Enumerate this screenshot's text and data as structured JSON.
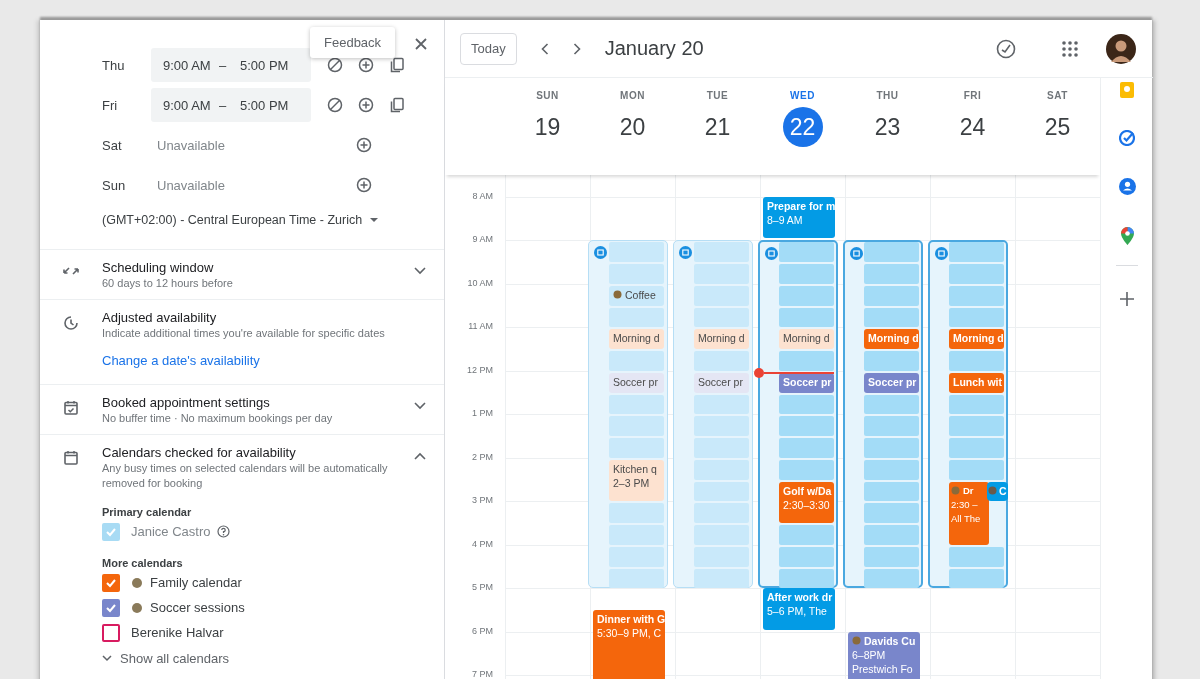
{
  "panel": {
    "feedback": "Feedback",
    "days": [
      {
        "label": "Thu",
        "kind": "hours",
        "start": "9:00 AM",
        "dash": "–",
        "end": "5:00 PM"
      },
      {
        "label": "Fri",
        "kind": "hours",
        "start": "9:00 AM",
        "dash": "–",
        "end": "5:00 PM"
      },
      {
        "label": "Sat",
        "kind": "unavailable",
        "text": "Unavailable"
      },
      {
        "label": "Sun",
        "kind": "unavailable",
        "text": "Unavailable"
      }
    ],
    "timezone": "(GMT+02:00) - Central European Time - Zurich",
    "sections": [
      {
        "kind": "window",
        "title": "Scheduling window",
        "subtitle": "60 days to 12 hours before",
        "expanded": false
      },
      {
        "kind": "adjusted",
        "title": "Adjusted availability",
        "subtitle": "Indicate additional times you're available for specific dates",
        "link": "Change a date's availability"
      },
      {
        "kind": "booked",
        "title": "Booked appointment settings",
        "subtitle": "No buffer time · No maximum bookings per day",
        "expanded": false
      },
      {
        "kind": "calendars",
        "title": "Calendars checked for availability",
        "subtitle": "Any busy times on selected calendars will be automatically removed for booking",
        "expanded": true
      }
    ],
    "primary_heading": "Primary calendar",
    "primary": [
      {
        "name": "Janice Castro",
        "checked": true,
        "disabled": true,
        "color": "#a8dbf4",
        "help": true
      }
    ],
    "more_heading": "More calendars",
    "calendars": [
      {
        "name": "Family calendar",
        "checked": true,
        "disabled": false,
        "color": "#f4660c",
        "icon": true
      },
      {
        "name": "Soccer sessions",
        "checked": true,
        "disabled": false,
        "color": "#7986cb",
        "icon": true
      },
      {
        "name": "Berenike Halvar",
        "checked": false,
        "disabled": false,
        "color": "#d81b60"
      }
    ],
    "show_all": "Show all calendars"
  },
  "calendar": {
    "today_button": "Today",
    "title": "January 20",
    "time_labels": [
      "8 AM",
      "9 AM",
      "10 AM",
      "11 AM",
      "12 PM",
      "1 PM",
      "2 PM",
      "3 PM",
      "4 PM",
      "5 PM",
      "6 PM",
      "7 PM"
    ],
    "days": [
      {
        "label": "SUN",
        "date": "19",
        "selected": false
      },
      {
        "label": "MON",
        "date": "20",
        "selected": false,
        "before": [
          {
            "kind": "free"
          },
          {
            "kind": "free"
          }
        ],
        "block": {
          "highlighted": false,
          "cells": [
            {
              "kind": "slot"
            },
            {
              "kind": "slot"
            },
            {
              "kind": "event",
              "lines": [
                "Coffee"
              ],
              "color": "#c9e9fa",
              "faded": true,
              "icon": true
            },
            {
              "kind": "slot"
            },
            {
              "kind": "event",
              "lines": [
                "Morning d"
              ],
              "color": "#fde2d0",
              "faded": true
            },
            {
              "kind": "slot"
            },
            {
              "kind": "event",
              "lines": [
                "Soccer pr"
              ],
              "color": "#e4e6f4",
              "faded": true
            },
            {
              "kind": "slot"
            },
            {
              "kind": "slot"
            },
            {
              "kind": "slot"
            },
            {
              "kind": "event",
              "lines": [
                "Kitchen q",
                "2–3 PM"
              ],
              "color": "#fde2d0",
              "faded": true
            },
            {
              "kind": "cont"
            },
            {
              "kind": "slot"
            },
            {
              "kind": "slot"
            },
            {
              "kind": "slot"
            },
            {
              "kind": "slot"
            }
          ]
        },
        "after": [
          {
            "kind": "free"
          },
          {
            "kind": "event",
            "lines": [
              "Dinner with G",
              "5:30–9 PM, C"
            ],
            "color": "#f4660c",
            "faded": false
          },
          {
            "kind": "cont"
          },
          {
            "kind": "cont"
          },
          {
            "kind": "cont"
          },
          {
            "kind": "cont"
          }
        ]
      },
      {
        "label": "TUE",
        "date": "21",
        "selected": false,
        "before": [
          {
            "kind": "free"
          },
          {
            "kind": "free"
          }
        ],
        "block": {
          "highlighted": false,
          "cells": [
            {
              "kind": "slot"
            },
            {
              "kind": "slot"
            },
            {
              "kind": "slot"
            },
            {
              "kind": "slot"
            },
            {
              "kind": "event",
              "lines": [
                "Morning d"
              ],
              "color": "#fde2d0",
              "faded": true
            },
            {
              "kind": "slot"
            },
            {
              "kind": "event",
              "lines": [
                "Soccer pr"
              ],
              "color": "#e4e6f4",
              "faded": true
            },
            {
              "kind": "slot"
            },
            {
              "kind": "slot"
            },
            {
              "kind": "slot"
            },
            {
              "kind": "slot"
            },
            {
              "kind": "slot"
            },
            {
              "kind": "slot"
            },
            {
              "kind": "slot"
            },
            {
              "kind": "slot"
            },
            {
              "kind": "slot"
            }
          ]
        }
      },
      {
        "label": "WED",
        "date": "22",
        "selected": true,
        "before": [
          {
            "kind": "event",
            "lines": [
              "Prepare for m",
              "8–9 AM"
            ],
            "color": "#039be5",
            "faded": false
          },
          {
            "kind": "cont"
          }
        ],
        "block": {
          "highlighted": true,
          "cells": [
            {
              "kind": "slot"
            },
            {
              "kind": "slot"
            },
            {
              "kind": "slot"
            },
            {
              "kind": "slot"
            },
            {
              "kind": "event",
              "lines": [
                "Morning d"
              ],
              "color": "#fde2d0",
              "faded": true
            },
            {
              "kind": "slot"
            },
            {
              "kind": "event",
              "lines": [
                "Soccer pr"
              ],
              "color": "#7986cb",
              "faded": false,
              "now": true
            },
            {
              "kind": "slot"
            },
            {
              "kind": "slot"
            },
            {
              "kind": "slot"
            },
            {
              "kind": "slot"
            },
            {
              "kind": "event",
              "lines": [
                "Golf w/Da",
                "2:30–3:30"
              ],
              "color": "#f4660c",
              "faded": false
            },
            {
              "kind": "cont"
            },
            {
              "kind": "slot"
            },
            {
              "kind": "slot"
            },
            {
              "kind": "slot"
            }
          ]
        },
        "after": [
          {
            "kind": "event",
            "lines": [
              "After work dr",
              "5–6 PM, The"
            ],
            "color": "#039be5",
            "faded": false
          },
          {
            "kind": "cont"
          }
        ]
      },
      {
        "label": "THU",
        "date": "23",
        "selected": false,
        "before": [
          {
            "kind": "free"
          },
          {
            "kind": "free"
          }
        ],
        "block": {
          "highlighted": true,
          "cells": [
            {
              "kind": "slot"
            },
            {
              "kind": "slot"
            },
            {
              "kind": "slot"
            },
            {
              "kind": "slot"
            },
            {
              "kind": "event",
              "lines": [
                "Morning d"
              ],
              "color": "#f4660c",
              "faded": false
            },
            {
              "kind": "slot"
            },
            {
              "kind": "event",
              "lines": [
                "Soccer pr"
              ],
              "color": "#7986cb",
              "faded": false
            },
            {
              "kind": "slot"
            },
            {
              "kind": "slot"
            },
            {
              "kind": "slot"
            },
            {
              "kind": "slot"
            },
            {
              "kind": "slot"
            },
            {
              "kind": "slot"
            },
            {
              "kind": "slot"
            },
            {
              "kind": "slot"
            },
            {
              "kind": "slot"
            }
          ]
        },
        "after": [
          {
            "kind": "free"
          },
          {
            "kind": "free"
          },
          {
            "kind": "event",
            "lines": [
              "Davids Cu",
              "6–8PM",
              "Prestwich Fo"
            ],
            "color": "#7986cb",
            "faded": false,
            "icon": true
          },
          {
            "kind": "cont"
          },
          {
            "kind": "cont"
          },
          {
            "kind": "cont"
          }
        ]
      },
      {
        "label": "FRI",
        "date": "24",
        "selected": false,
        "before": [
          {
            "kind": "free"
          },
          {
            "kind": "free"
          }
        ],
        "block": {
          "highlighted": true,
          "cells": [
            {
              "kind": "slot"
            },
            {
              "kind": "slot"
            },
            {
              "kind": "slot"
            },
            {
              "kind": "slot"
            },
            {
              "kind": "event",
              "lines": [
                "Morning d"
              ],
              "color": "#f4660c",
              "faded": false
            },
            {
              "kind": "slot"
            },
            {
              "kind": "event",
              "lines": [
                "Lunch wit"
              ],
              "color": "#f4660c",
              "faded": false
            },
            {
              "kind": "slot"
            },
            {
              "kind": "slot"
            },
            {
              "kind": "slot"
            },
            {
              "kind": "slot"
            },
            {
              "kind": "event",
              "lines": [
                "Dr",
                "2:30 –",
                "All The"
              ],
              "color": "#f4660c",
              "faded": false,
              "icon": true,
              "chip": {
                "lines": [
                  "C"
                ],
                "color": "#039be5",
                "icon": true
              }
            },
            {
              "kind": "cont"
            },
            {
              "kind": "cont"
            },
            {
              "kind": "slot"
            },
            {
              "kind": "slot"
            }
          ]
        }
      },
      {
        "label": "SAT",
        "date": "25",
        "selected": false
      }
    ]
  }
}
